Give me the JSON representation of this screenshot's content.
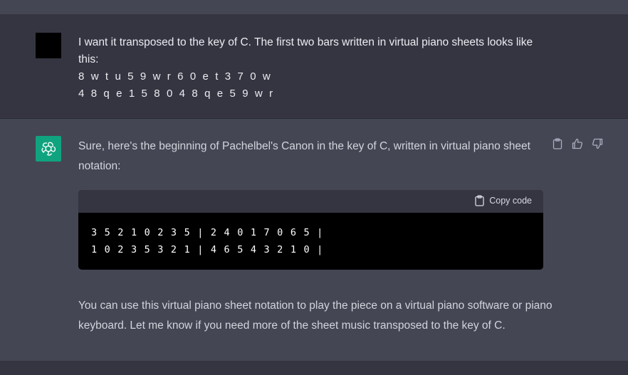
{
  "user_message": {
    "intro": "I want it transposed to the key of C. The first two bars written in virtual piano sheets looks like this:",
    "line1": "8 w t u 5 9 w r 6 0 e t 3 7 0 w",
    "line2": "4 8 q e 1 5 8 0 4 8 q e 5 9 w r"
  },
  "assistant_message": {
    "intro": "Sure, here's the beginning of Pachelbel's Canon in the key of C, written in virtual piano sheet notation:",
    "copy_label": "Copy code",
    "code_line1": "3 5 2 1 0 2 3 5 | 2 4 0 1 7 0 6 5 |",
    "code_line2": "1 0 2 3 5 3 2 1 | 4 6 5 4 3 2 1 0 |",
    "outro": "You can use this virtual piano sheet notation to play the piece on a virtual piano software or piano keyboard. Let me know if you need more of the sheet music transposed to the key of C."
  },
  "icons": {
    "copy": "clipboard-icon",
    "thumbs_up": "thumbs-up-icon",
    "thumbs_down": "thumbs-down-icon",
    "bot": "openai-logo-icon"
  },
  "colors": {
    "bot_avatar": "#10a37f",
    "assistant_bg": "#444654",
    "user_bg": "#343541"
  }
}
